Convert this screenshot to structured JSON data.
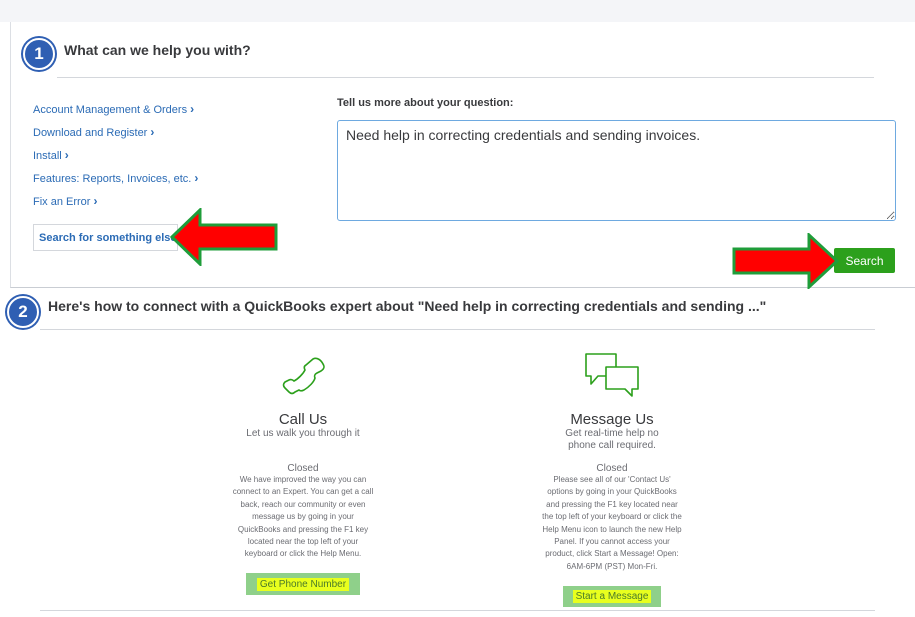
{
  "step1": {
    "number": "1",
    "title": "What can we help you with?",
    "topics": [
      {
        "label": "Account Management & Orders",
        "chevron": "›"
      },
      {
        "label": "Download and Register",
        "chevron": "›"
      },
      {
        "label": "Install",
        "chevron": "›"
      },
      {
        "label": "Features: Reports, Invoices, etc.",
        "chevron": "›"
      },
      {
        "label": "Fix an Error",
        "chevron": "›"
      }
    ],
    "search_else_label": "Search for something else",
    "question_label": "Tell us more about your question:",
    "question_value": "Need help in correcting credentials and sending invoices.",
    "search_button": "Search"
  },
  "step2": {
    "number": "2",
    "title": "Here's how to connect with a QuickBooks expert about \"Need help in correcting credentials and sending ...\"",
    "call": {
      "icon": "phone-icon",
      "title": "Call Us",
      "subtitle": "Let us walk you through it",
      "status": "Closed",
      "body_lines": [
        "We have improved the way you can",
        "connect to an Expert. You can get a call",
        "back, reach our community or even",
        "message us by going in your",
        "QuickBooks and pressing the F1 key",
        "located near the top left of your",
        "keyboard or click the Help Menu."
      ],
      "button": "Get Phone Number"
    },
    "message": {
      "icon": "chat-bubbles-icon",
      "title": "Message Us",
      "subtitle_lines": [
        "Get real-time help no",
        "phone call required."
      ],
      "status": "Closed",
      "body_lines": [
        "Please see all of our 'Contact Us'",
        "options by going in your QuickBooks",
        "and pressing the F1 key located near",
        "the top left of your keyboard or click the",
        "Help Menu icon to launch the new Help",
        "Panel. If you cannot access your",
        "product, click Start a Message! Open:",
        "6AM-6PM (PST) Mon-Fri."
      ],
      "button": "Start a Message"
    }
  },
  "colors": {
    "link": "#2b6bb5",
    "badge": "#2f5fb3",
    "search_green": "#2ca01c",
    "arrow_red": "#ff0000",
    "arrow_outline": "#1f9d3a",
    "highlight_yellow": "#e8ff1e",
    "icon_green": "#2ca01c"
  }
}
